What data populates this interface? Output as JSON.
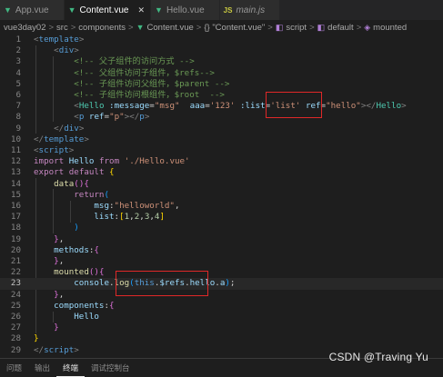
{
  "tabs": [
    {
      "name": "App.vue",
      "type": "vue",
      "active": false,
      "close": ""
    },
    {
      "name": "Content.vue",
      "type": "vue",
      "active": true,
      "close": "✕"
    },
    {
      "name": "Hello.vue",
      "type": "vue",
      "active": false,
      "close": ""
    },
    {
      "name": "main.js",
      "type": "js",
      "active": false,
      "close": ""
    }
  ],
  "breadcrumb": {
    "items": [
      "vue3day02",
      "src",
      "components",
      "Content.vue",
      "{} \"Content.vue\"",
      "script",
      "default",
      "mounted"
    ],
    "separator": ">"
  },
  "editor": {
    "current_line": 23,
    "lines": [
      {
        "n": "1",
        "tokens": [
          [
            "t-punc",
            "<"
          ],
          [
            "t-tag",
            "template"
          ],
          [
            "t-punc",
            ">"
          ]
        ]
      },
      {
        "n": "2",
        "tokens": [
          [
            "t-plain",
            "    "
          ],
          [
            "t-punc",
            "<"
          ],
          [
            "t-tag",
            "div"
          ],
          [
            "t-punc",
            ">"
          ]
        ]
      },
      {
        "n": "3",
        "tokens": [
          [
            "t-plain",
            "        "
          ],
          [
            "t-com",
            "<!-- 父子组件的访问方式 -->"
          ]
        ]
      },
      {
        "n": "4",
        "tokens": [
          [
            "t-plain",
            "        "
          ],
          [
            "t-com",
            "<!-- 父组件访问子组件，$refs-->"
          ]
        ]
      },
      {
        "n": "5",
        "tokens": [
          [
            "t-plain",
            "        "
          ],
          [
            "t-com",
            "<!-- 子组件访问父组件，$parent -->"
          ]
        ]
      },
      {
        "n": "6",
        "tokens": [
          [
            "t-plain",
            "        "
          ],
          [
            "t-com",
            "<!-- 子组件访问根组件，$root  -->"
          ]
        ]
      },
      {
        "n": "7",
        "tokens": [
          [
            "t-plain",
            "        "
          ],
          [
            "t-punc",
            "<"
          ],
          [
            "t-cls",
            "Hello"
          ],
          [
            "t-plain",
            " "
          ],
          [
            "t-attr",
            ":message"
          ],
          [
            "t-plain",
            "="
          ],
          [
            "t-str",
            "\"msg\""
          ],
          [
            "t-plain",
            "  "
          ],
          [
            "t-attr",
            "aaa"
          ],
          [
            "t-plain",
            "="
          ],
          [
            "t-str",
            "'123'"
          ],
          [
            "t-plain",
            " "
          ],
          [
            "t-attr",
            ":list"
          ],
          [
            "t-plain",
            "="
          ],
          [
            "t-str",
            "'list'"
          ],
          [
            "t-plain",
            " "
          ],
          [
            "t-attr",
            "ref"
          ],
          [
            "t-plain",
            "="
          ],
          [
            "t-str",
            "\"hello\""
          ],
          [
            "t-punc",
            "></"
          ],
          [
            "t-cls",
            "Hello"
          ],
          [
            "t-punc",
            ">"
          ]
        ]
      },
      {
        "n": "8",
        "tokens": [
          [
            "t-plain",
            "        "
          ],
          [
            "t-punc",
            "<"
          ],
          [
            "t-tag",
            "p"
          ],
          [
            "t-plain",
            " "
          ],
          [
            "t-attr",
            "ref"
          ],
          [
            "t-plain",
            "="
          ],
          [
            "t-str",
            "\"p\""
          ],
          [
            "t-punc",
            "></"
          ],
          [
            "t-tag",
            "p"
          ],
          [
            "t-punc",
            ">"
          ]
        ]
      },
      {
        "n": "9",
        "tokens": [
          [
            "t-plain",
            "    "
          ],
          [
            "t-punc",
            "</"
          ],
          [
            "t-tag",
            "div"
          ],
          [
            "t-punc",
            ">"
          ]
        ]
      },
      {
        "n": "10",
        "tokens": [
          [
            "t-punc",
            "</"
          ],
          [
            "t-tag",
            "template"
          ],
          [
            "t-punc",
            ">"
          ]
        ]
      },
      {
        "n": "11",
        "tokens": [
          [
            "t-punc",
            "<"
          ],
          [
            "t-tag",
            "script"
          ],
          [
            "t-punc",
            ">"
          ]
        ]
      },
      {
        "n": "12",
        "tokens": [
          [
            "t-kw",
            "import"
          ],
          [
            "t-plain",
            " "
          ],
          [
            "t-var",
            "Hello"
          ],
          [
            "t-plain",
            " "
          ],
          [
            "t-kw",
            "from"
          ],
          [
            "t-plain",
            " "
          ],
          [
            "t-str",
            "'./Hello.vue'"
          ]
        ]
      },
      {
        "n": "13",
        "tokens": [
          [
            "t-kw",
            "export"
          ],
          [
            "t-plain",
            " "
          ],
          [
            "t-kw",
            "default"
          ],
          [
            "t-plain",
            " "
          ],
          [
            "t-brk1",
            "{"
          ]
        ]
      },
      {
        "n": "14",
        "tokens": [
          [
            "t-plain",
            "    "
          ],
          [
            "t-fn",
            "data"
          ],
          [
            "t-brk2",
            "()"
          ],
          [
            "t-brk2",
            "{"
          ]
        ]
      },
      {
        "n": "15",
        "tokens": [
          [
            "t-plain",
            "        "
          ],
          [
            "t-kw",
            "return"
          ],
          [
            "t-brk3",
            "("
          ]
        ]
      },
      {
        "n": "16",
        "tokens": [
          [
            "t-plain",
            "            "
          ],
          [
            "t-var",
            "msg"
          ],
          [
            "t-plain",
            ":"
          ],
          [
            "t-str",
            "\"helloworld\""
          ],
          [
            "t-plain",
            ","
          ]
        ]
      },
      {
        "n": "17",
        "tokens": [
          [
            "t-plain",
            "            "
          ],
          [
            "t-var",
            "list"
          ],
          [
            "t-plain",
            ":"
          ],
          [
            "t-brk1",
            "["
          ],
          [
            "t-num",
            "1"
          ],
          [
            "t-plain",
            ","
          ],
          [
            "t-num",
            "2"
          ],
          [
            "t-plain",
            ","
          ],
          [
            "t-num",
            "3"
          ],
          [
            "t-plain",
            ","
          ],
          [
            "t-num",
            "4"
          ],
          [
            "t-brk1",
            "]"
          ]
        ]
      },
      {
        "n": "18",
        "tokens": [
          [
            "t-plain",
            "        "
          ],
          [
            "t-brk3",
            ")"
          ]
        ]
      },
      {
        "n": "19",
        "tokens": [
          [
            "t-plain",
            "    "
          ],
          [
            "t-brk2",
            "}"
          ],
          [
            "t-plain",
            ","
          ]
        ]
      },
      {
        "n": "20",
        "tokens": [
          [
            "t-plain",
            "    "
          ],
          [
            "t-var",
            "methods"
          ],
          [
            "t-plain",
            ":"
          ],
          [
            "t-brk2",
            "{"
          ]
        ]
      },
      {
        "n": "21",
        "tokens": [
          [
            "t-plain",
            "    "
          ],
          [
            "t-brk2",
            "}"
          ],
          [
            "t-plain",
            ","
          ]
        ]
      },
      {
        "n": "22",
        "tokens": [
          [
            "t-plain",
            "    "
          ],
          [
            "t-fn",
            "mounted"
          ],
          [
            "t-brk2",
            "()"
          ],
          [
            "t-brk2",
            "{"
          ]
        ]
      },
      {
        "n": "23",
        "tokens": [
          [
            "t-plain",
            "        "
          ],
          [
            "t-var",
            "console"
          ],
          [
            "t-plain",
            "."
          ],
          [
            "t-fn",
            "log"
          ],
          [
            "t-brk3",
            "("
          ],
          [
            "t-this",
            "this"
          ],
          [
            "t-plain",
            "."
          ],
          [
            "t-var",
            "$refs"
          ],
          [
            "t-plain",
            "."
          ],
          [
            "t-var",
            "hello"
          ],
          [
            "t-plain",
            "."
          ],
          [
            "t-var",
            "a"
          ],
          [
            "t-brk3",
            ")"
          ],
          [
            "t-plain",
            ";"
          ]
        ]
      },
      {
        "n": "24",
        "tokens": [
          [
            "t-plain",
            "    "
          ],
          [
            "t-brk2",
            "}"
          ],
          [
            "t-plain",
            ","
          ]
        ]
      },
      {
        "n": "25",
        "tokens": [
          [
            "t-plain",
            "    "
          ],
          [
            "t-var",
            "components"
          ],
          [
            "t-plain",
            ":"
          ],
          [
            "t-brk2",
            "{"
          ]
        ]
      },
      {
        "n": "26",
        "tokens": [
          [
            "t-plain",
            "        "
          ],
          [
            "t-var",
            "Hello"
          ]
        ]
      },
      {
        "n": "27",
        "tokens": [
          [
            "t-plain",
            "    "
          ],
          [
            "t-brk2",
            "}"
          ]
        ]
      },
      {
        "n": "28",
        "tokens": [
          [
            "t-brk1",
            "}"
          ]
        ]
      },
      {
        "n": "29",
        "tokens": [
          [
            "t-punc",
            "</"
          ],
          [
            "t-tag",
            "script"
          ],
          [
            "t-punc",
            ">"
          ]
        ]
      }
    ]
  },
  "panel_tabs": [
    {
      "label": "问题",
      "active": false
    },
    {
      "label": "输出",
      "active": false
    },
    {
      "label": "终端",
      "active": true
    },
    {
      "label": "调试控制台",
      "active": false
    }
  ],
  "watermark": "CSDN @Traving Yu",
  "colors": {
    "editor_bg": "#1e1e1e",
    "tab_bg": "#2d2d2d",
    "highlight_box": "#e02828",
    "vue_green": "#41b883"
  },
  "icons": {
    "vue_file": "vue-logo-icon",
    "js_file": "js-file-icon",
    "close": "close-icon"
  }
}
